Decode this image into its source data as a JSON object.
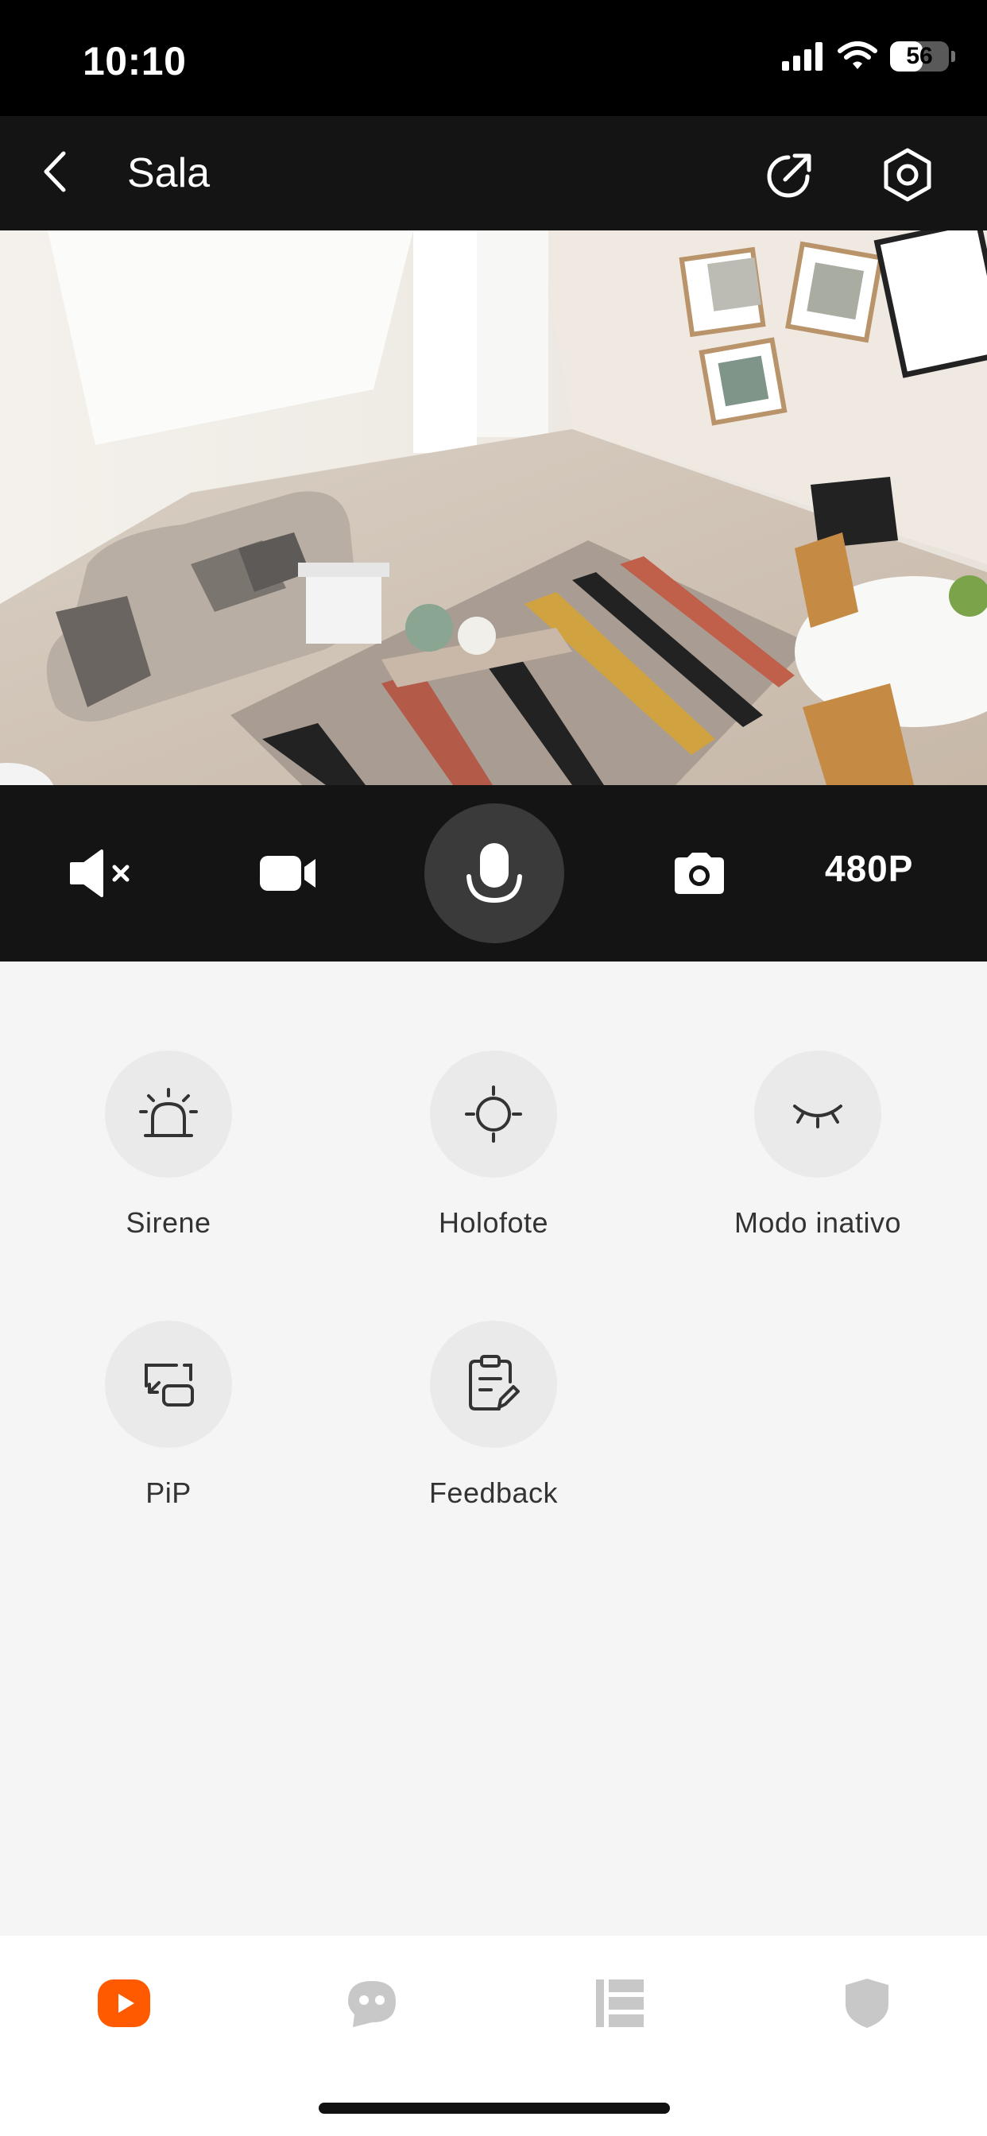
{
  "status_bar": {
    "time": "10:10",
    "battery_level": "56"
  },
  "nav": {
    "title": "Sala"
  },
  "controls": {
    "quality_label": "480P"
  },
  "features": [
    {
      "label": "Sirene",
      "icon": "siren-icon"
    },
    {
      "label": "Holofote",
      "icon": "spotlight-icon"
    },
    {
      "label": "Modo inativo",
      "icon": "eye-closed-icon"
    },
    {
      "label": "PiP",
      "icon": "pip-icon"
    },
    {
      "label": "Feedback",
      "icon": "feedback-icon"
    }
  ],
  "tabs": [
    {
      "icon": "play-icon",
      "active": true
    },
    {
      "icon": "message-icon",
      "active": false
    },
    {
      "icon": "list-icon",
      "active": false
    },
    {
      "icon": "shield-icon",
      "active": false
    }
  ],
  "colors": {
    "accent": "#ff5a00",
    "dark_bar": "#141414",
    "inactive_icon": "#c8c8c8"
  }
}
